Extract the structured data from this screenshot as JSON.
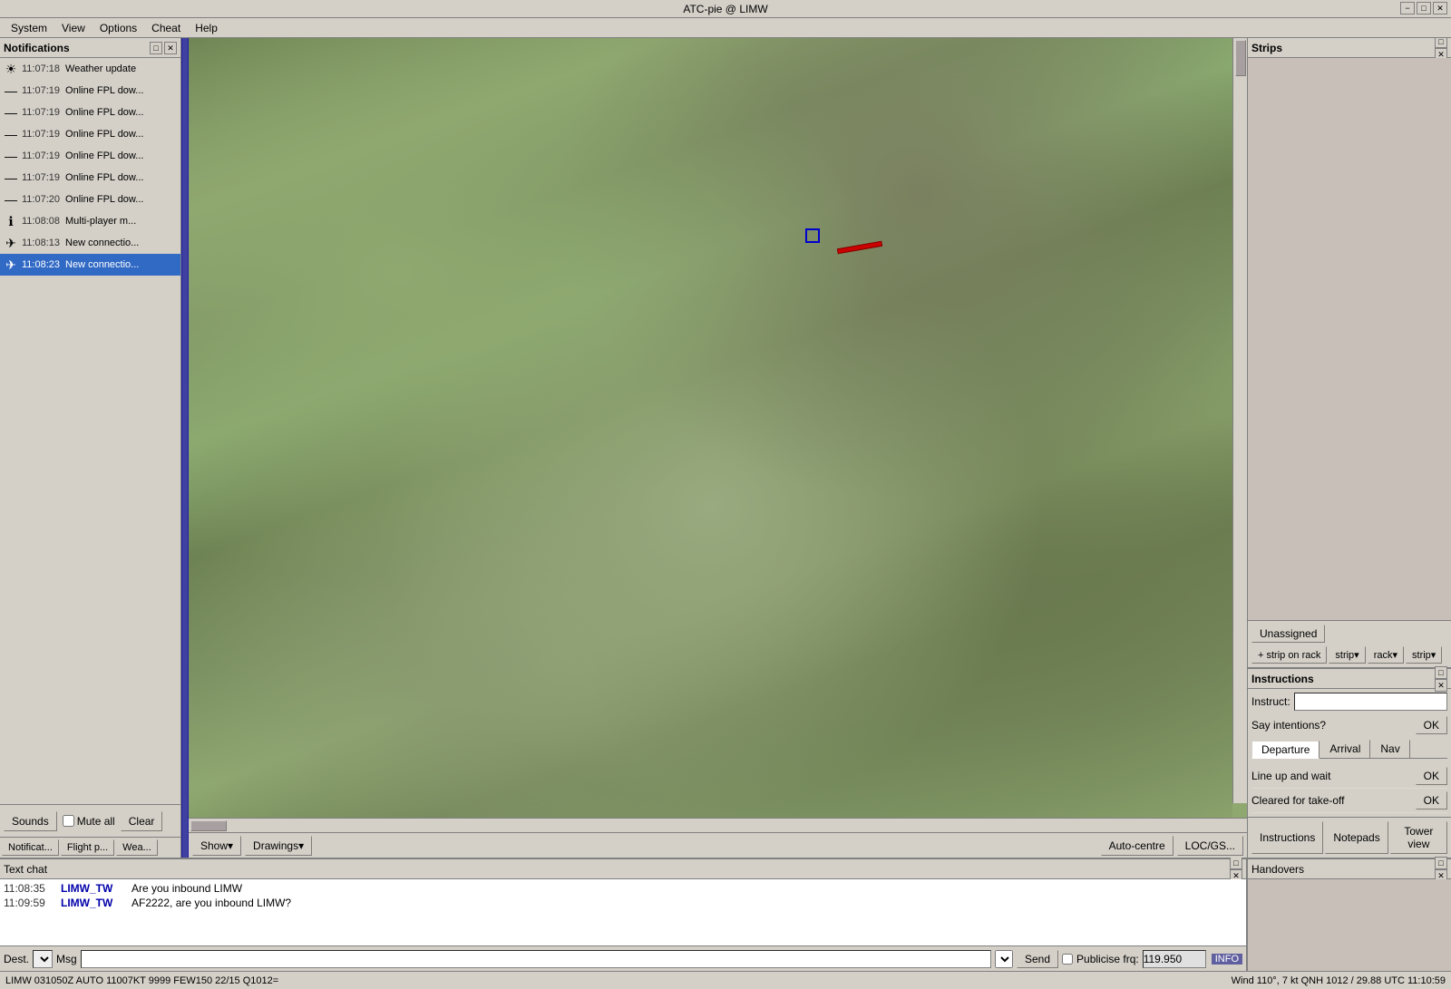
{
  "window": {
    "title": "ATC-pie @ LIMW",
    "min_btn": "−",
    "max_btn": "□",
    "close_btn": "✕"
  },
  "menubar": {
    "items": [
      "System",
      "View",
      "Options",
      "Cheat",
      "Help"
    ]
  },
  "left_panel": {
    "header": "Notifications",
    "notifications": [
      {
        "time": "11:07:18",
        "icon": "☀",
        "text": "Weather update",
        "type": "weather"
      },
      {
        "time": "11:07:19",
        "icon": "—",
        "text": "Online FPL dow...",
        "type": "fpl"
      },
      {
        "time": "11:07:19",
        "icon": "—",
        "text": "Online FPL dow...",
        "type": "fpl"
      },
      {
        "time": "11:07:19",
        "icon": "—",
        "text": "Online FPL dow...",
        "type": "fpl"
      },
      {
        "time": "11:07:19",
        "icon": "—",
        "text": "Online FPL dow...",
        "type": "fpl"
      },
      {
        "time": "11:07:19",
        "icon": "—",
        "text": "Online FPL dow...",
        "type": "fpl"
      },
      {
        "time": "11:07:20",
        "icon": "—",
        "text": "Online FPL dow...",
        "type": "fpl"
      },
      {
        "time": "11:08:08",
        "icon": "ℹ",
        "text": "Multi-player m...",
        "type": "info"
      },
      {
        "time": "11:08:13",
        "icon": "✈",
        "text": "New connectio...",
        "type": "conn"
      },
      {
        "time": "11:08:23",
        "icon": "✈",
        "text": "New connectio...",
        "type": "conn",
        "selected": true
      }
    ],
    "footer": {
      "sounds_btn": "Sounds",
      "mute_all_label": "Mute all",
      "clear_btn": "Clear"
    },
    "tabs": [
      "Notificat...",
      "Flight p...",
      "Wea..."
    ]
  },
  "map": {
    "show_btn": "Show▾",
    "drawings_btn": "Drawings▾",
    "auto_centre_btn": "Auto-centre",
    "loc_gs_btn": "LOC/GS..."
  },
  "right_panel": {
    "strips_header": "Strips",
    "unassigned_tab": "Unassigned",
    "strip_on_rack_btn": "+ strip on rack",
    "strip_btn": "strip▾",
    "rack_btn": "rack▾",
    "strip2_btn": "strip▾"
  },
  "instructions": {
    "header": "Instructions",
    "instruct_label": "Instruct:",
    "instruct_placeholder": "",
    "say_intentions_label": "Say intentions?",
    "say_ok_btn": "OK",
    "tabs": [
      "Departure",
      "Arrival",
      "Nav"
    ],
    "active_tab": "Departure",
    "items": [
      {
        "text": "Line up and wait",
        "has_ok": true
      },
      {
        "text": "Cleared for take-off",
        "has_ok": true
      }
    ],
    "footer_tabs": [
      "Instructions",
      "Notepads",
      "Tower view"
    ]
  },
  "chat": {
    "header": "Text chat",
    "messages": [
      {
        "time": "11:08:35",
        "sender": "LIMW_TW",
        "text": "Are you inbound LIMW"
      },
      {
        "time": "11:09:59",
        "sender": "LIMW_TW",
        "text": "AF2222, are you inbound LIMW?"
      }
    ],
    "dest_label": "Dest.",
    "msg_label": "Msg",
    "send_btn": "Send",
    "publicise_frq_label": "Publicise frq:",
    "frq_value": "119.950",
    "info_tag": "INFO"
  },
  "handovers": {
    "header": "Handovers"
  },
  "status_bar": {
    "left": "LIMW 031050Z AUTO 11007KT 9999 FEW150 22/15 Q1012=",
    "right": "Wind 110°, 7 kt  QNH 1012 / 29.88  UTC 11:10:59"
  }
}
